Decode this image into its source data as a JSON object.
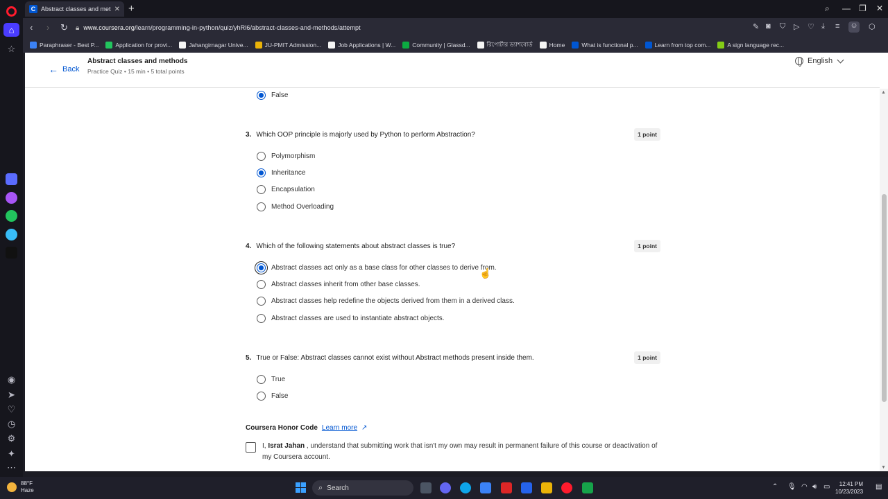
{
  "browser": {
    "tab_title": "Abstract classes and meth",
    "tab_favicon": "C",
    "url_domain": "www.coursera.org",
    "url_path": "/learn/programming-in-python/quiz/yhRl6/abstract-classes-and-methods/attempt",
    "bookmarks": [
      {
        "label": "Paraphraser - Best P...",
        "color": "#3b82f6"
      },
      {
        "label": "Application for provi...",
        "color": "#22c55e"
      },
      {
        "label": "Jahangirnagar Unive...",
        "color": "#f5f5f5"
      },
      {
        "label": "JU-PMIT Admission...",
        "color": "#eab308"
      },
      {
        "label": "Job Applications | W...",
        "color": "#f5f5f5"
      },
      {
        "label": "Community | Glassd...",
        "color": "#0caa41"
      },
      {
        "label": "রিপোর্টার ড্যাশবোর্ড",
        "color": "#f5f5f5"
      },
      {
        "label": "Home",
        "color": "#f5f5f5"
      },
      {
        "label": "What is functional p...",
        "color": "#0056d2"
      },
      {
        "label": "Learn from top com...",
        "color": "#0056d2"
      },
      {
        "label": "A sign language rec...",
        "color": "#84cc16"
      }
    ]
  },
  "header": {
    "back_label": "Back",
    "title": "Abstract classes and methods",
    "subtitle": "Practice Quiz • 15 min • 5 total points",
    "language": "English"
  },
  "prev_option": {
    "label": "False",
    "selected": true
  },
  "questions": [
    {
      "number": "3.",
      "text": "Which OOP principle is majorly used by Python to perform Abstraction?",
      "points": "1 point",
      "options": [
        {
          "label": "Polymorphism",
          "selected": false
        },
        {
          "label": "Inheritance",
          "selected": true
        },
        {
          "label": "Encapsulation",
          "selected": false
        },
        {
          "label": "Method Overloading",
          "selected": false
        }
      ]
    },
    {
      "number": "4.",
      "text": "Which of the following statements about abstract classes is true?",
      "points": "1 point",
      "options": [
        {
          "label": "Abstract classes act only as a base class for other classes to derive from.",
          "selected": true
        },
        {
          "label": "Abstract classes inherit from other base classes.",
          "selected": false
        },
        {
          "label": "Abstract classes help redefine the objects derived from them in a derived class.",
          "selected": false
        },
        {
          "label": "Abstract classes are used to instantiate abstract objects.",
          "selected": false
        }
      ]
    },
    {
      "number": "5.",
      "text": "True or False: Abstract classes cannot exist without Abstract methods present inside them.",
      "points": "1 point",
      "options": [
        {
          "label": "True",
          "selected": false
        },
        {
          "label": "False",
          "selected": false
        }
      ]
    }
  ],
  "honor": {
    "title": "Coursera Honor Code",
    "learn_more": "Learn more",
    "pre": "I, ",
    "name": "Israt Jahan",
    "post": " , understand that submitting work that isn't my own may result in permanent failure of this course or deactivation of my Coursera account.",
    "checked": false
  },
  "taskbar": {
    "temp": "88°F",
    "condition": "Haze",
    "search_label": "Search",
    "time": "12:41 PM",
    "date": "10/23/2023"
  },
  "colors": {
    "accent": "#0056d2",
    "opera_red": "#ff1b2d"
  }
}
